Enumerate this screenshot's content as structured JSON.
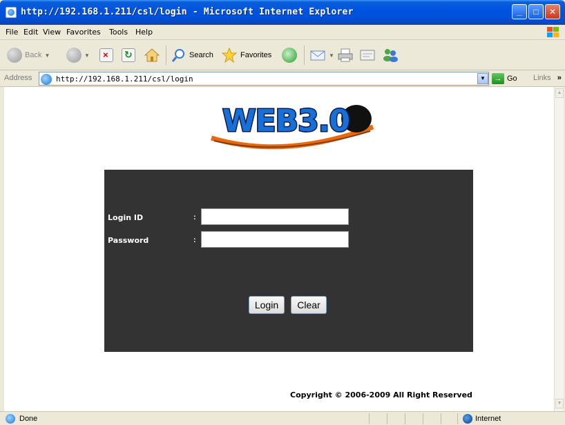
{
  "window": {
    "title": "http://192.168.1.211/csl/login - Microsoft Internet Explorer"
  },
  "menu": [
    {
      "label": "File"
    },
    {
      "label": "Edit"
    },
    {
      "label": "View"
    },
    {
      "label": "Favorites"
    },
    {
      "label": "Tools"
    },
    {
      "label": "Help"
    }
  ],
  "toolbar": {
    "back_label": "Back",
    "search_label": "Search",
    "favorites_label": "Favorites"
  },
  "address": {
    "label": "Address",
    "url": "http://192.168.1.211/csl/login",
    "go_label": "Go",
    "links_label": "Links"
  },
  "page": {
    "logo_text": "WEB3.0",
    "login_id_label": "Login ID",
    "password_label": "Password",
    "colon": ":",
    "login_id_value": "",
    "password_value": "",
    "login_button": "Login",
    "clear_button": "Clear",
    "copyright": "Copyright © 2006-2009 All Right Reserved"
  },
  "status": {
    "text": "Done",
    "zone": "Internet"
  },
  "colors": {
    "panel": "#333333",
    "titlebar": "#0053e0"
  }
}
